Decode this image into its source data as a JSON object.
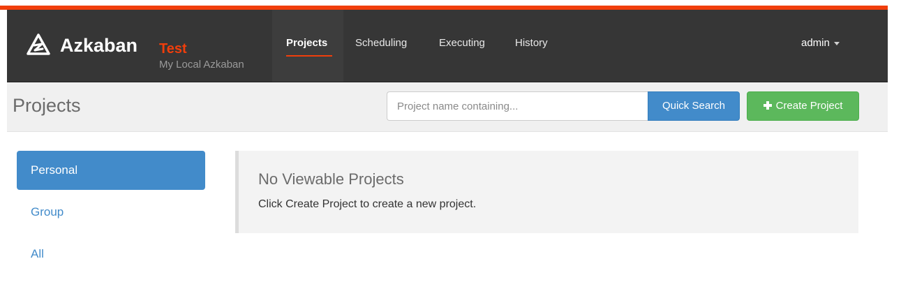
{
  "brand": {
    "name": "Azkaban",
    "env": "Test",
    "subtitle": "My Local Azkaban",
    "logo_icon": "azkaban-logo-icon"
  },
  "nav": {
    "items": [
      {
        "label": "Projects",
        "active": true
      },
      {
        "label": "Scheduling",
        "active": false
      },
      {
        "label": "Executing",
        "active": false
      },
      {
        "label": "History",
        "active": false
      }
    ],
    "user": "admin"
  },
  "header": {
    "title": "Projects",
    "search": {
      "placeholder": "Project name containing...",
      "value": ""
    },
    "quick_search_label": "Quick Search",
    "create_project_label": "Create Project"
  },
  "sidebar": {
    "items": [
      {
        "label": "Personal",
        "active": true
      },
      {
        "label": "Group",
        "active": false
      },
      {
        "label": "All",
        "active": false
      }
    ]
  },
  "main": {
    "empty_title": "No Viewable Projects",
    "empty_text": "Click Create Project to create a new project."
  },
  "colors": {
    "accent_red": "#f13e0b",
    "navbar_bg": "#363636",
    "primary_blue": "#428bca",
    "success_green": "#5cb85c"
  }
}
